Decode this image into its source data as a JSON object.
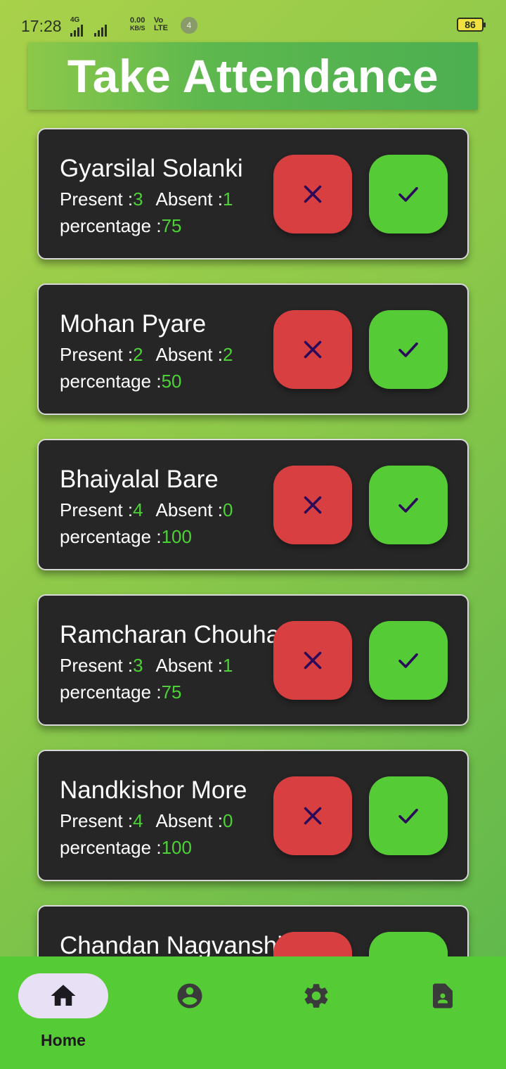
{
  "status_bar": {
    "time": "17:28",
    "network": "4G",
    "speed_value": "0.00",
    "speed_unit": "KB/S",
    "volte_top": "Vo",
    "volte_bottom": "LTE",
    "notification_count": "4",
    "battery": "86"
  },
  "header": {
    "title": "Take Attendance"
  },
  "labels": {
    "present": "Present :",
    "absent": "Absent :",
    "percentage": "percentage :"
  },
  "students": [
    {
      "name": "Gyarsilal Solanki",
      "present": "3",
      "absent": "1",
      "percentage": "75"
    },
    {
      "name": "Mohan Pyare",
      "present": "2",
      "absent": "2",
      "percentage": "50"
    },
    {
      "name": "Bhaiyalal Bare",
      "present": "4",
      "absent": "0",
      "percentage": "100"
    },
    {
      "name": "Ramcharan Chouhan",
      "present": "3",
      "absent": "1",
      "percentage": "75"
    },
    {
      "name": "Nandkishor More",
      "present": "4",
      "absent": "0",
      "percentage": "100"
    },
    {
      "name": "Chandan Nagvanshi",
      "present": "",
      "absent": "",
      "percentage": ""
    }
  ],
  "bottom_nav": {
    "items": [
      {
        "icon": "home-icon",
        "label": "Home",
        "active": true
      },
      {
        "icon": "account-icon",
        "label": "",
        "active": false
      },
      {
        "icon": "settings-icon",
        "label": "",
        "active": false
      },
      {
        "icon": "report-icon",
        "label": "",
        "active": false
      }
    ]
  },
  "colors": {
    "card_bg": "#262626",
    "value_green": "#4cd137",
    "absent_button": "#d73f40",
    "present_button": "#55cc36",
    "nav_bg": "#55cc36",
    "icon_dark": "#2b0a5a"
  }
}
